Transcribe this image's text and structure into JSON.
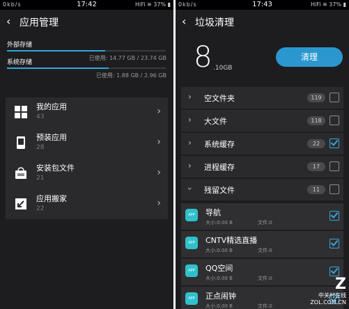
{
  "left": {
    "status": {
      "net": "0kb/s",
      "time": "17:42",
      "signal": "HiFi",
      "battery": "37%"
    },
    "title": "应用管理",
    "storage": [
      {
        "label": "外部存储",
        "used": "已使用: 14.77 GB / 23.74 GB",
        "fraction": 0.62
      },
      {
        "label": "系统存储",
        "used": "已使用: 1.88 GB / 2.96 GB",
        "fraction": 0.64
      }
    ],
    "apps": [
      {
        "name": "我的应用",
        "count": "43",
        "icon": "grid-icon"
      },
      {
        "name": "预装应用",
        "count": "28",
        "icon": "device-icon"
      },
      {
        "name": "安装包文件",
        "count": "21",
        "icon": "apk-icon"
      },
      {
        "name": "应用搬家",
        "count": "22",
        "icon": "move-icon"
      }
    ]
  },
  "right": {
    "status": {
      "net": "0kb/s",
      "time": "17:43",
      "signal": "HiFi",
      "battery": "37%"
    },
    "title": "垃圾清理",
    "amount": "8",
    "amount_unit": ".10GB",
    "clean_button": "清理",
    "categories": [
      {
        "name": "空文件夹",
        "count": "119",
        "checked": false,
        "expanded": false
      },
      {
        "name": "大文件",
        "count": "118",
        "checked": false,
        "expanded": false
      },
      {
        "name": "系统缓存",
        "count": "22",
        "checked": true,
        "expanded": false
      },
      {
        "name": "进程缓存",
        "count": "17",
        "checked": false,
        "expanded": false
      },
      {
        "name": "残留文件",
        "count": "11",
        "checked": false,
        "expanded": true
      }
    ],
    "residuals": [
      {
        "name": "导航",
        "size": "大小:0.00 B",
        "files": "文件:0",
        "checked": true
      },
      {
        "name": "CNTV精选直播",
        "size": "大小:0.00 B",
        "files": "文件:0",
        "checked": true
      },
      {
        "name": "QQ空间",
        "size": "大小:0.00 B",
        "files": "文件:0",
        "checked": true
      },
      {
        "name": "正点闹钟",
        "size": "大小:0.00 B",
        "files": "文件:0",
        "checked": true
      }
    ]
  },
  "watermark": {
    "logo": "Z",
    "text": "中关村在线",
    "site": "ZOL.COM.CN"
  }
}
